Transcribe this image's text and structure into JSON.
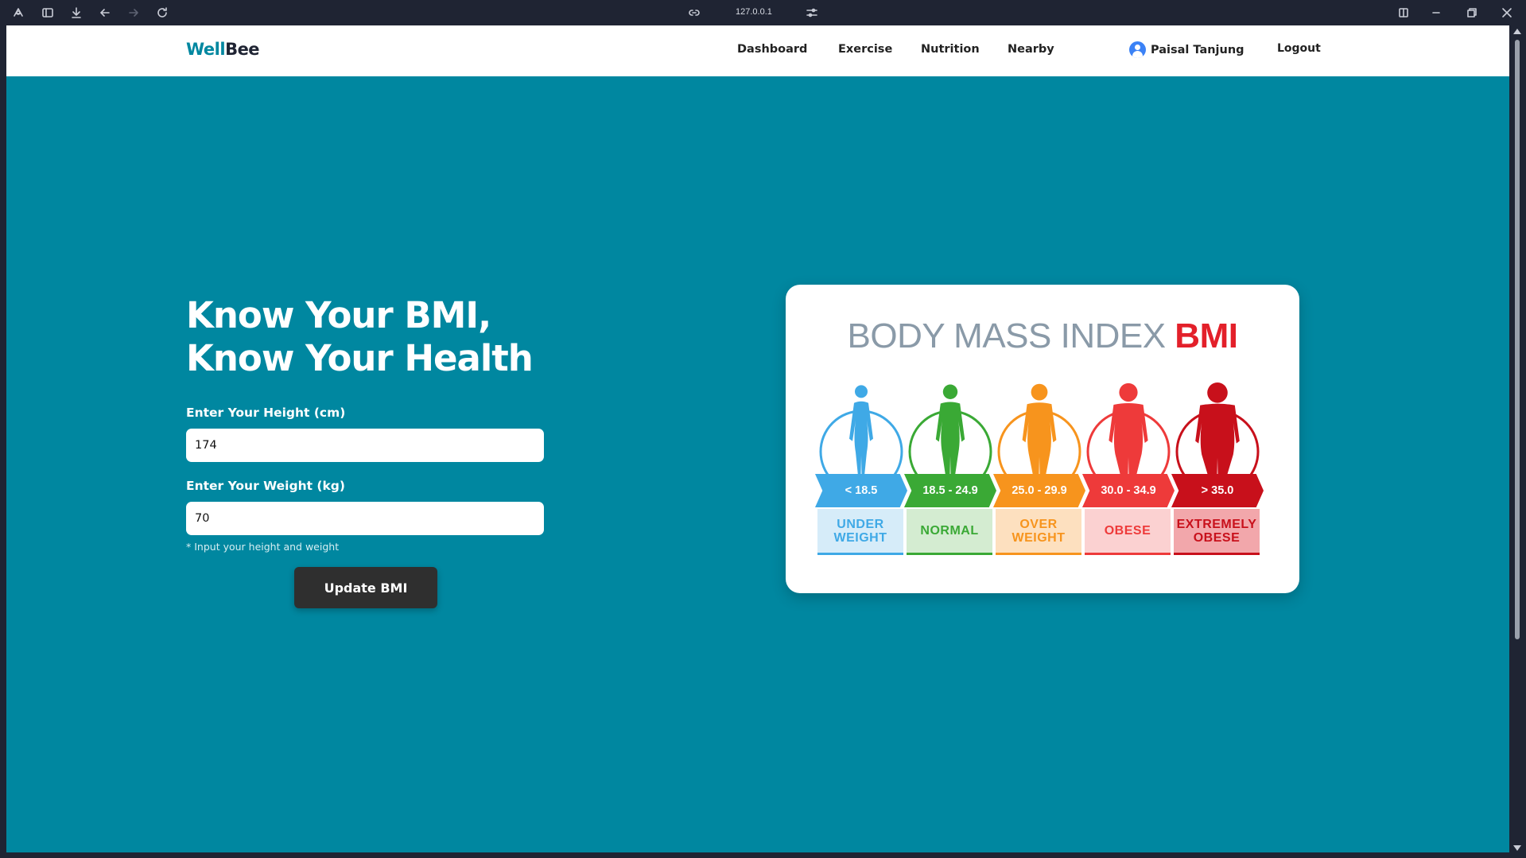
{
  "browser": {
    "url": "127.0.0.1"
  },
  "navbar": {
    "logo_part1": "Well",
    "logo_part2": "Bee",
    "links": [
      "Dashboard",
      "Exercise",
      "Nutrition",
      "Nearby"
    ],
    "user_name": "Paisal Tanjung",
    "logout_label": "Logout"
  },
  "hero": {
    "title_line1": "Know Your BMI,",
    "title_line2": "Know Your Health",
    "height_label": "Enter Your Height (cm)",
    "height_value": "174",
    "weight_label": "Enter Your Weight (kg)",
    "weight_value": "70",
    "hint": "* Input your height and weight",
    "button_label": "Update BMI"
  },
  "bmi_chart": {
    "title_light": "BODY MASS INDEX ",
    "title_strong": "BMI",
    "categories": [
      {
        "range": "< 18.5",
        "label_line1": "UNDER",
        "label_line2": "WEIGHT",
        "color": "#3fa9e6",
        "bg": "#d6ecf9",
        "text_color": "#3fa9e6",
        "underline": "#3fa9e6",
        "girth": 0
      },
      {
        "range": "18.5 - 24.9",
        "label_line1": "NORMAL",
        "label_line2": "",
        "color": "#3aa935",
        "bg": "#d4ecd1",
        "text_color": "#3aa935",
        "underline": "#3aa935",
        "girth": 1
      },
      {
        "range": "25.0 - 29.9",
        "label_line1": "OVER",
        "label_line2": "WEIGHT",
        "color": "#f7941d",
        "bg": "#fde0bf",
        "text_color": "#f7941d",
        "underline": "#f7941d",
        "girth": 2
      },
      {
        "range": "30.0 - 34.9",
        "label_line1": "OBESE",
        "label_line2": "",
        "color": "#ee3a3a",
        "bg": "#fbd1d1",
        "text_color": "#ee3a3a",
        "underline": "#ee3a3a",
        "girth": 3
      },
      {
        "range": "> 35.0",
        "label_line1": "EXTREMELY",
        "label_line2": "OBESE",
        "color": "#c8101b",
        "bg": "#f2a7ab",
        "text_color": "#c8101b",
        "underline": "#c8101b",
        "girth": 4
      }
    ]
  }
}
